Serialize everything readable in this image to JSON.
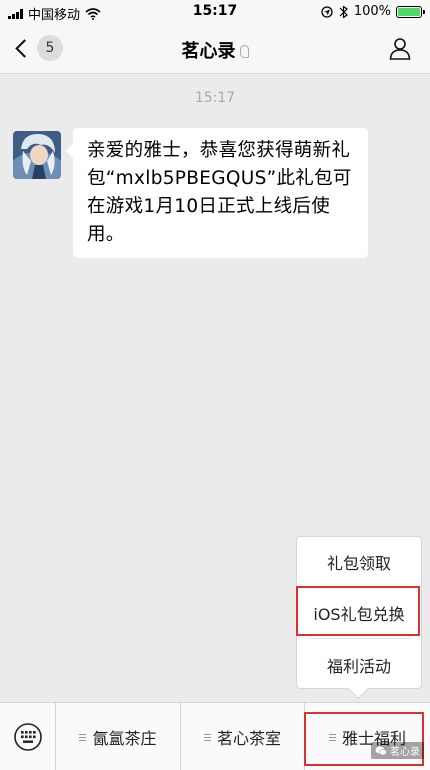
{
  "status_bar": {
    "carrier": "中国移动",
    "time": "15:17",
    "battery_percent": "100%",
    "battery_level": 1.0,
    "icons": [
      "signal-icon",
      "wifi-icon",
      "location-icon",
      "alarm-icon",
      "battery-icon"
    ]
  },
  "nav": {
    "back_count": "5",
    "title": "茗心录",
    "icons": [
      "back-chevron-icon",
      "ear-icon",
      "profile-icon"
    ]
  },
  "chat": {
    "timestamp": "15:17",
    "message": "亲爱的雅士，恭喜您获得萌新礼包“mxlb5PBEGQUS”此礼包可在游戏1月10日正式上线后使用。"
  },
  "submenu": {
    "items": [
      "礼包领取",
      "iOS礼包兑换",
      "福利活动"
    ],
    "highlighted": "iOS礼包兑换"
  },
  "menu_bar": {
    "items": [
      "氤氲茶庄",
      "茗心茶室",
      "雅士福利"
    ],
    "highlighted": "雅士福利",
    "keyboard_icon": "keyboard-icon"
  },
  "watermark": "茗心录",
  "colors": {
    "background": "#ebebeb",
    "highlight_border": "#d93030",
    "battery_green": "#4cd964"
  }
}
